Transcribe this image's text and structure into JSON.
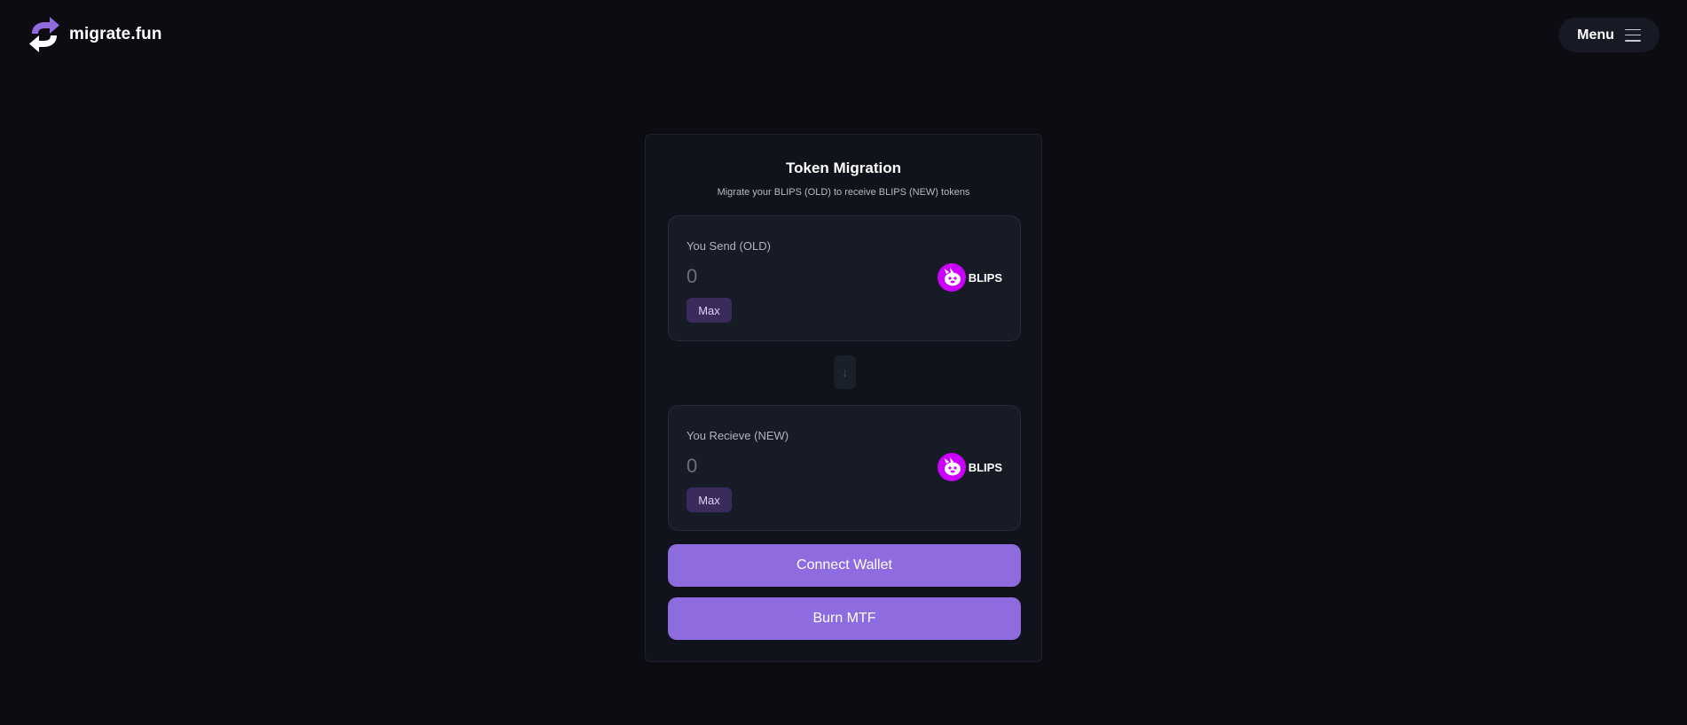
{
  "header": {
    "logo_text": "migrate.fun",
    "logo_icon": "refresh-arrows-icon",
    "menu_label": "Menu",
    "menu_icon": "hamburger-icon"
  },
  "colors": {
    "background": "#0c0c12",
    "card": "#11131c",
    "panel": "#171b26",
    "accent": "#8e6ce0",
    "max_button": "#3b2b5c",
    "token_logo": "#cc00ff"
  },
  "migration": {
    "title": "Token Migration",
    "subtitle": "Migrate your BLIPS (OLD) to receive BLIPS (NEW) tokens",
    "send": {
      "label": "You Send (OLD)",
      "placeholder": "0",
      "max_label": "Max",
      "token_symbol": "BLIPS",
      "token_icon": "blips-token-icon"
    },
    "swap_icon": "arrow-down-icon",
    "swap_glyph": "↓",
    "receive": {
      "label": "You Recieve (NEW)",
      "placeholder": "0",
      "max_label": "Max",
      "token_symbol": "BLIPS",
      "token_icon": "blips-token-icon"
    },
    "connect_wallet_label": "Connect Wallet",
    "burn_label": "Burn MTF"
  }
}
